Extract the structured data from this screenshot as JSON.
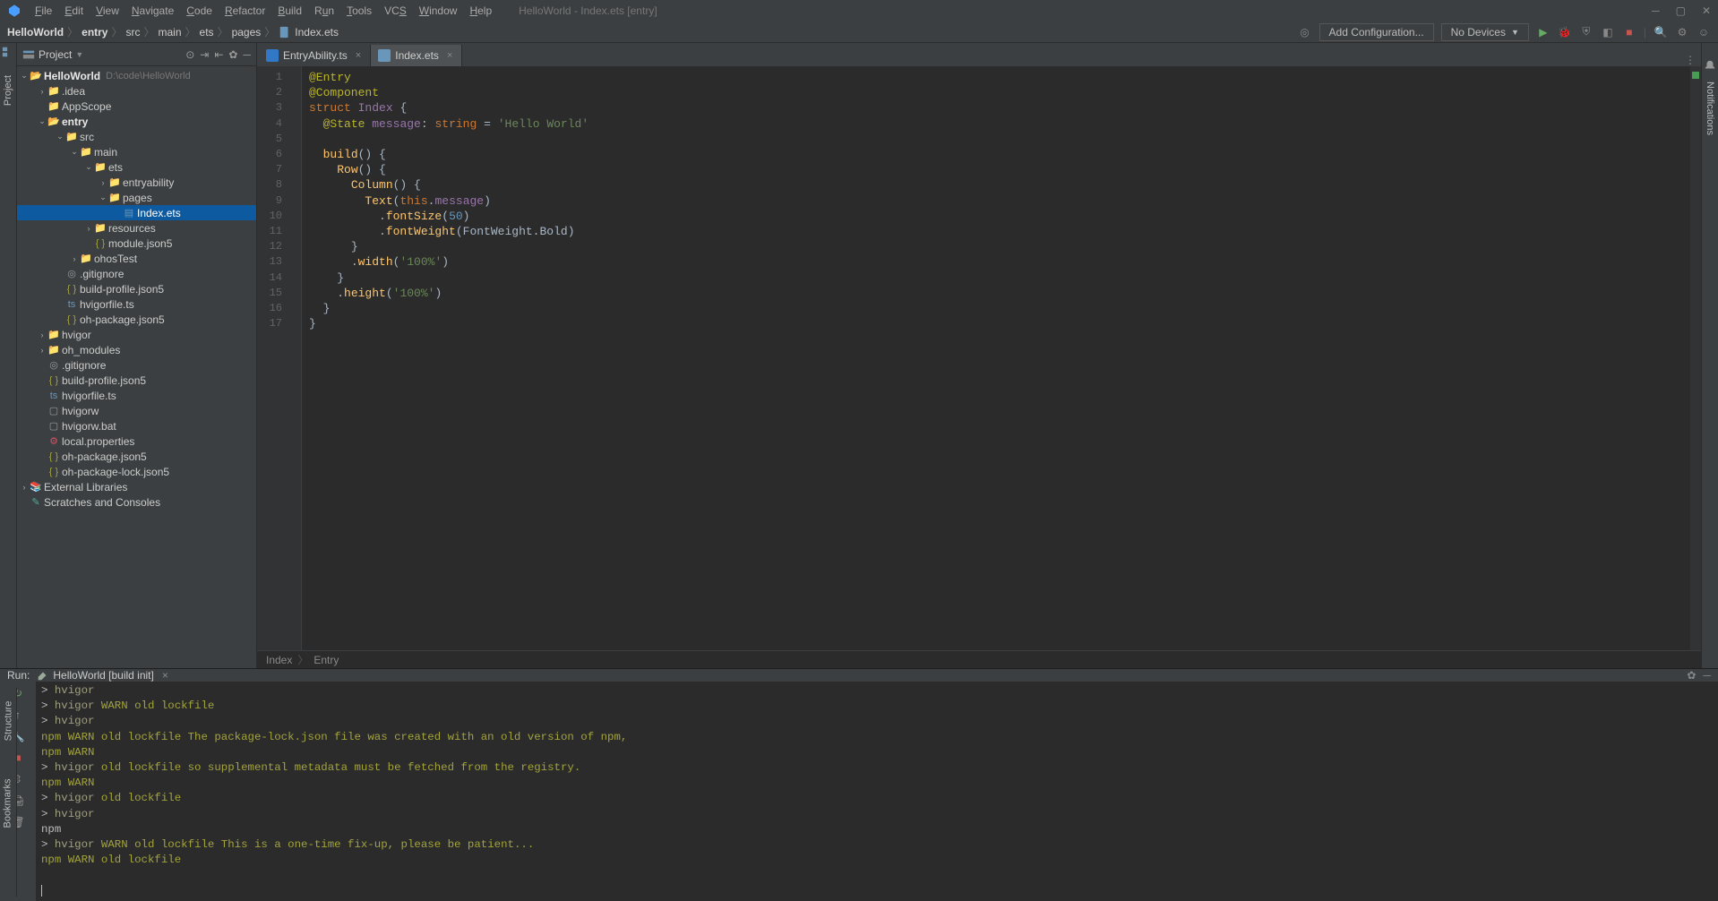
{
  "window": {
    "title": "HelloWorld - Index.ets [entry]"
  },
  "menu": [
    "File",
    "Edit",
    "View",
    "Navigate",
    "Code",
    "Refactor",
    "Build",
    "Run",
    "Tools",
    "VCS",
    "Window",
    "Help"
  ],
  "breadcrumb": [
    "HelloWorld",
    "entry",
    "src",
    "main",
    "ets",
    "pages",
    "Index.ets"
  ],
  "nav": {
    "add_config": "Add Configuration...",
    "devices": "No Devices"
  },
  "project_panel": {
    "title": "Project"
  },
  "tree": {
    "root": {
      "name": "HelloWorld",
      "path": "D:\\code\\HelloWorld"
    },
    "items": [
      ".idea",
      "AppScope",
      "entry",
      "src",
      "main",
      "ets",
      "entryability",
      "pages",
      "Index.ets",
      "resources",
      "module.json5",
      "ohosTest",
      ".gitignore",
      "build-profile.json5",
      "hvigorfile.ts",
      "oh-package.json5",
      "hvigor",
      "oh_modules",
      ".gitignore",
      "build-profile.json5",
      "hvigorfile.ts",
      "hvigorw",
      "hvigorw.bat",
      "local.properties",
      "oh-package.json5",
      "oh-package-lock.json5",
      "External Libraries",
      "Scratches and Consoles"
    ]
  },
  "editor": {
    "tabs": [
      {
        "label": "EntryAbility.ts",
        "active": false
      },
      {
        "label": "Index.ets",
        "active": true
      }
    ],
    "line_count": 17,
    "code_tokens": {
      "l1": "@Entry",
      "l2": "@Component",
      "l3_k": "struct",
      "l3_id": "Index",
      "l4_a": "@State",
      "l4_m": "message",
      "l4_t": "string",
      "l4_s": "'Hello World'",
      "l6": "build",
      "l7": "Row",
      "l8": "Column",
      "l9": "Text",
      "l9_this": "this",
      "l9_prop": "message",
      "l10": "fontSize",
      "l10_n": "50",
      "l11": "fontWeight",
      "l11_a": "FontWeight",
      "l11_b": "Bold",
      "l13": "width",
      "l13_s": "'100%'",
      "l15": "height",
      "l15_s": "'100%'"
    },
    "crumb": [
      "Index",
      "Entry"
    ]
  },
  "run": {
    "label": "Run:",
    "tab": "HelloWorld [build init]",
    "lines": [
      {
        "prefix": "> ",
        "name": "hvigor",
        "rest": ""
      },
      {
        "prefix": "> ",
        "name": "hvigor",
        "rest": " WARN old lockfile",
        "warn": true
      },
      {
        "prefix": "> ",
        "name": "hvigor",
        "rest": ""
      },
      {
        "np": "npm WARN old lockfile The package-lock.json file was created with an old version of npm,",
        "warn": true
      },
      {
        "np": "npm WARN",
        "warn": true
      },
      {
        "prefix": "> ",
        "name": "hvigor",
        "rest": "  old lockfile so supplemental metadata must be fetched from the registry.",
        "warn": true
      },
      {
        "np": "npm WARN",
        "warn": true
      },
      {
        "prefix": "> ",
        "name": "hvigor",
        "rest": "  old lockfile",
        "warn": true
      },
      {
        "prefix": "> ",
        "name": "hvigor",
        "rest": ""
      },
      {
        "np": "npm"
      },
      {
        "prefix": "> ",
        "name": "hvigor",
        "rest": " WARN old lockfile This is a one-time fix-up, please be patient...",
        "warn": true
      },
      {
        "np": "npm WARN old lockfile",
        "warn": true
      }
    ]
  },
  "left_tabs": [
    "Project"
  ],
  "right_tabs": [
    "Notifications"
  ],
  "left_bottom_tabs": [
    "Structure",
    "Bookmarks"
  ]
}
